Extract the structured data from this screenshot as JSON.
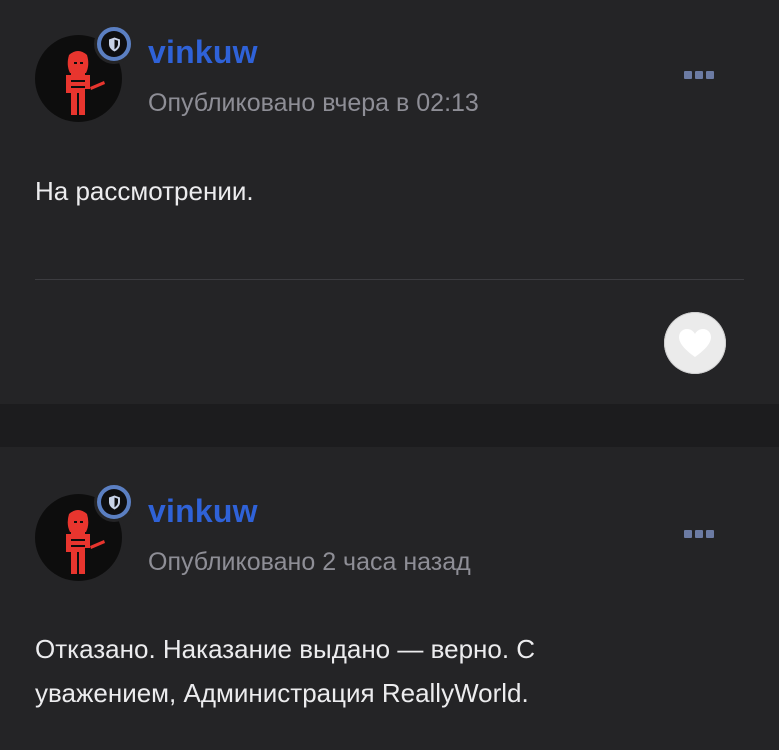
{
  "posts": [
    {
      "username": "vinkuw",
      "meta": "Опубликовано вчера в 02:13",
      "body": "На рассмотрении."
    },
    {
      "username": "vinkuw",
      "meta": "Опубликовано 2 часа назад",
      "body": "Отказано. Наказание выдано — верно. С уважением, Администрация ReallyWorld."
    }
  ],
  "colors": {
    "background": "#242426",
    "separator": "#1c1c1e",
    "username": "#2f62d8",
    "meta": "#8e8e96",
    "text": "#ececee",
    "badge": "#5b7fc2",
    "avatar_figure": "#e8352e"
  },
  "icons": {
    "badge": "shield-icon",
    "menu": "more-options-icon",
    "reaction": "heart-icon"
  }
}
